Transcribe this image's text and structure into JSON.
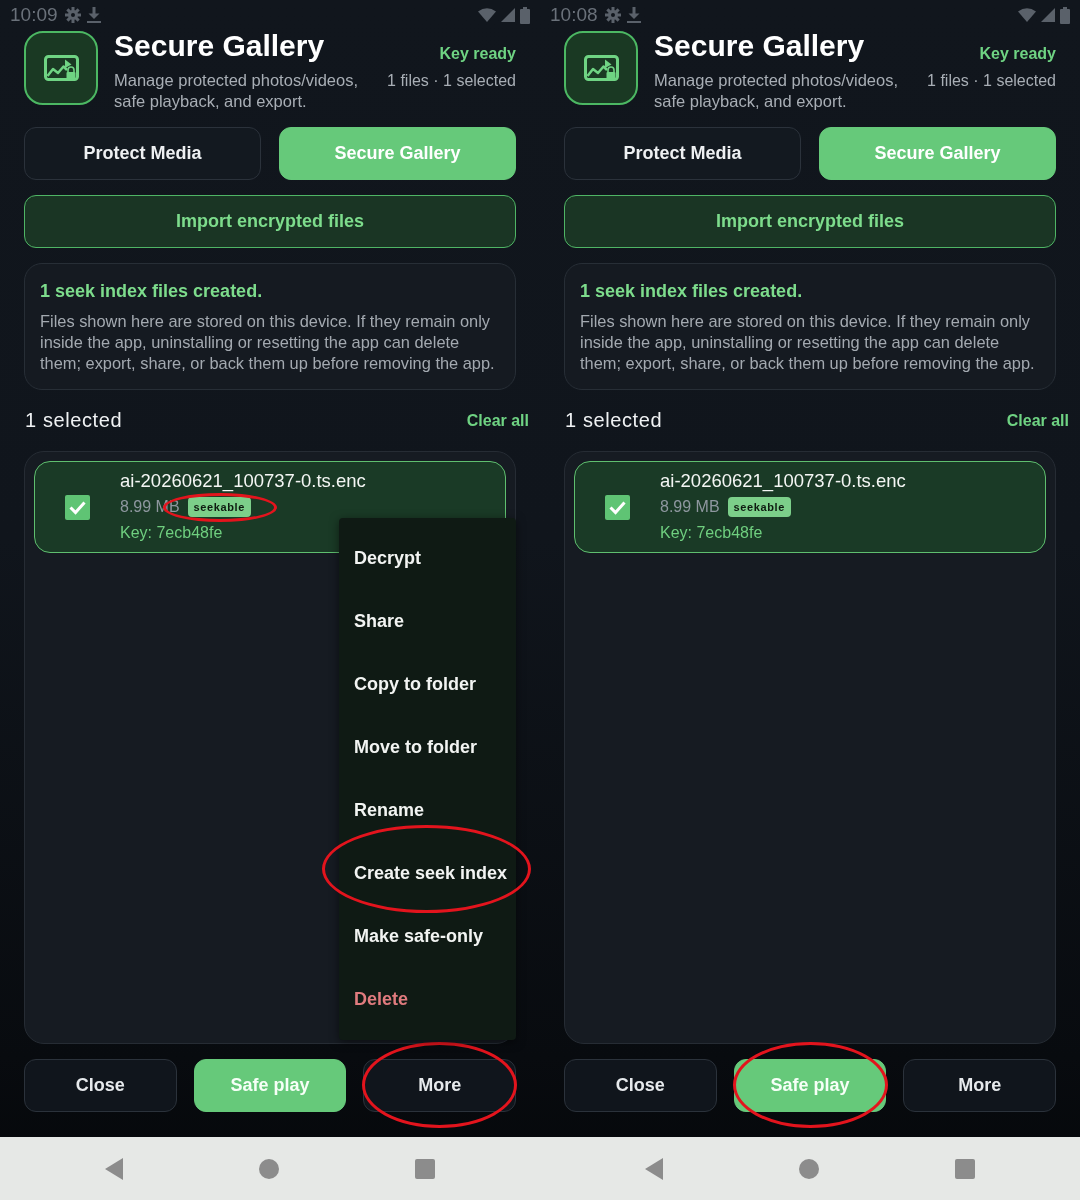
{
  "screens": [
    {
      "status_bar": {
        "time": "10:09"
      },
      "header": {
        "title": "Secure Gallery",
        "subtitle": "Manage protected photos/videos, safe playback, and export.",
        "key_status": "Key ready",
        "counts": "1 files · 1 selected"
      },
      "tabs": [
        {
          "label": "Protect Media",
          "selected": false
        },
        {
          "label": "Secure Gallery",
          "selected": true
        }
      ],
      "import_button": "Import encrypted files",
      "notice": {
        "title": "1 seek index files created.",
        "body": "Files shown here are stored on this device. If they remain only inside the app, uninstalling or resetting the app can delete them; export, share, or back them up before removing the app."
      },
      "selection": {
        "label": "1 selected",
        "clear": "Clear all"
      },
      "files": [
        {
          "name": "ai-20260621_100737-0.ts.enc",
          "size": "8.99 MB",
          "tag": "seekable",
          "tag_circled": true,
          "key": "Key: 7ecb48fe",
          "checked": true,
          "selected": true
        }
      ],
      "menu": {
        "items": [
          {
            "label": "Decrypt",
            "kind": "normal",
            "circled": false
          },
          {
            "label": "Share",
            "kind": "normal",
            "circled": false
          },
          {
            "label": "Copy to folder",
            "kind": "normal",
            "circled": false
          },
          {
            "label": "Move to folder",
            "kind": "normal",
            "circled": false
          },
          {
            "label": "Rename",
            "kind": "normal",
            "circled": false
          },
          {
            "label": "Create seek index",
            "kind": "normal",
            "circled": true
          },
          {
            "label": "Make safe-only",
            "kind": "normal",
            "circled": false
          },
          {
            "label": "Delete",
            "kind": "danger",
            "circled": false
          }
        ]
      },
      "actions": [
        {
          "label": "Close",
          "kind": "secondary",
          "circled": false
        },
        {
          "label": "Safe play",
          "kind": "primary",
          "circled": false
        },
        {
          "label": "More",
          "kind": "secondary",
          "circled": true
        }
      ]
    },
    {
      "status_bar": {
        "time": "10:08"
      },
      "header": {
        "title": "Secure Gallery",
        "subtitle": "Manage protected photos/videos, safe playback, and export.",
        "key_status": "Key ready",
        "counts": "1 files · 1 selected"
      },
      "tabs": [
        {
          "label": "Protect Media",
          "selected": false
        },
        {
          "label": "Secure Gallery",
          "selected": true
        }
      ],
      "import_button": "Import encrypted files",
      "notice": {
        "title": "1 seek index files created.",
        "body": "Files shown here are stored on this device. If they remain only inside the app, uninstalling or resetting the app can delete them; export, share, or back them up before removing the app."
      },
      "selection": {
        "label": "1 selected",
        "clear": "Clear all"
      },
      "files": [
        {
          "name": "ai-20260621_100737-0.ts.enc",
          "size": "8.99 MB",
          "tag": "seekable",
          "tag_circled": false,
          "key": "Key: 7ecb48fe",
          "checked": true,
          "selected": true
        }
      ],
      "actions": [
        {
          "label": "Close",
          "kind": "secondary",
          "circled": false
        },
        {
          "label": "Safe play",
          "kind": "primary",
          "circled": true
        },
        {
          "label": "More",
          "kind": "secondary",
          "circled": false
        }
      ]
    }
  ]
}
